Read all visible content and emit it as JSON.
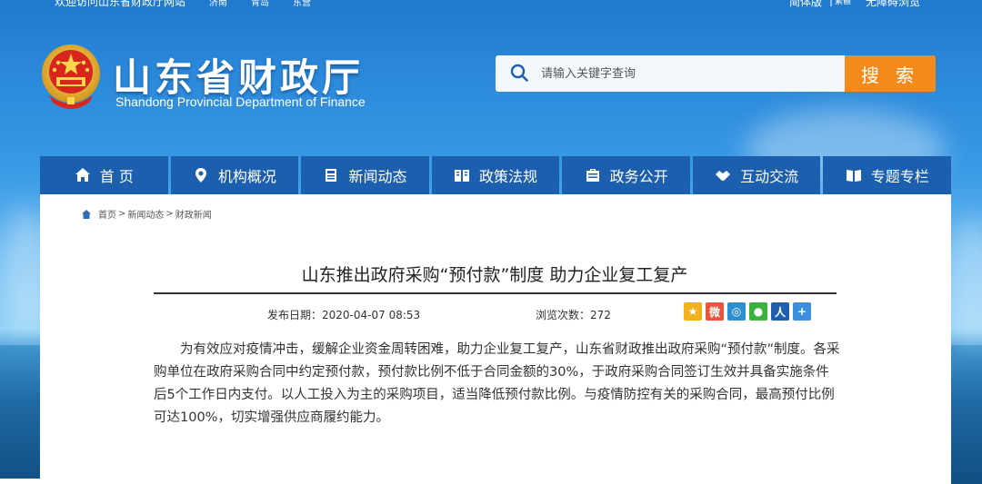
{
  "topbar": {
    "welcome": "欢迎访问山东省财政厅网站",
    "cities": [
      "济南",
      "青岛",
      "东营"
    ],
    "lang": "简体版",
    "separator": "|",
    "mark": "繁體",
    "accessibility": "无障碍浏览"
  },
  "header": {
    "title": "山东省财政厅",
    "subtitle": "Shandong Provincial Department of Finance"
  },
  "search": {
    "placeholder": "请输入关键字查询",
    "button": "搜 索"
  },
  "nav": {
    "items": [
      {
        "label": "首 页",
        "icon": "home-icon"
      },
      {
        "label": "机构概况",
        "icon": "location-pin-icon"
      },
      {
        "label": "新闻动态",
        "icon": "news-icon"
      },
      {
        "label": "政策法规",
        "icon": "book-icon"
      },
      {
        "label": "政务公开",
        "icon": "briefcase-icon"
      },
      {
        "label": "互动交流",
        "icon": "handshake-icon"
      },
      {
        "label": "专题专栏",
        "icon": "open-book-icon"
      }
    ]
  },
  "breadcrumb": {
    "home": "首页",
    "sep1": ">",
    "level1": "新闻动态",
    "sep2": ">",
    "level2": "财政新闻"
  },
  "article": {
    "title": "山东推出政府采购“预付款”制度 助力企业复工复产",
    "date_label": "发布日期：",
    "date": "2020-04-07 08:53",
    "views_label": "浏览次数：",
    "views": "272",
    "body": "为有效应对疫情冲击，缓解企业资金周转困难，助力企业复工复产，山东省财政推出政府采购“预付款”制度。各采购单位在政府采购合同中约定预付款，预付款比例不低于合同金额的30%，于政府采购合同签订生效并具备实施条件后5个工作日内支付。以人工投入为主的采购项目，适当降低预付款比例。与疫情防控有关的采购合同，最高预付比例可达100%，切实增强供应商履约能力。"
  },
  "share": [
    {
      "icon": "qzone-star-icon",
      "color": "#f0a81c"
    },
    {
      "icon": "weibo-icon",
      "color": "#e8553d"
    },
    {
      "icon": "tencent-weibo-icon",
      "color": "#2c8fd1"
    },
    {
      "icon": "wechat-icon",
      "color": "#3bb23d"
    },
    {
      "icon": "renren-icon",
      "color": "#1f5fae"
    },
    {
      "icon": "more-plus-icon",
      "color": "#3c8ede"
    }
  ],
  "colors": {
    "nav_bg": "#1c5fae",
    "search_button": "#f28a1c"
  }
}
